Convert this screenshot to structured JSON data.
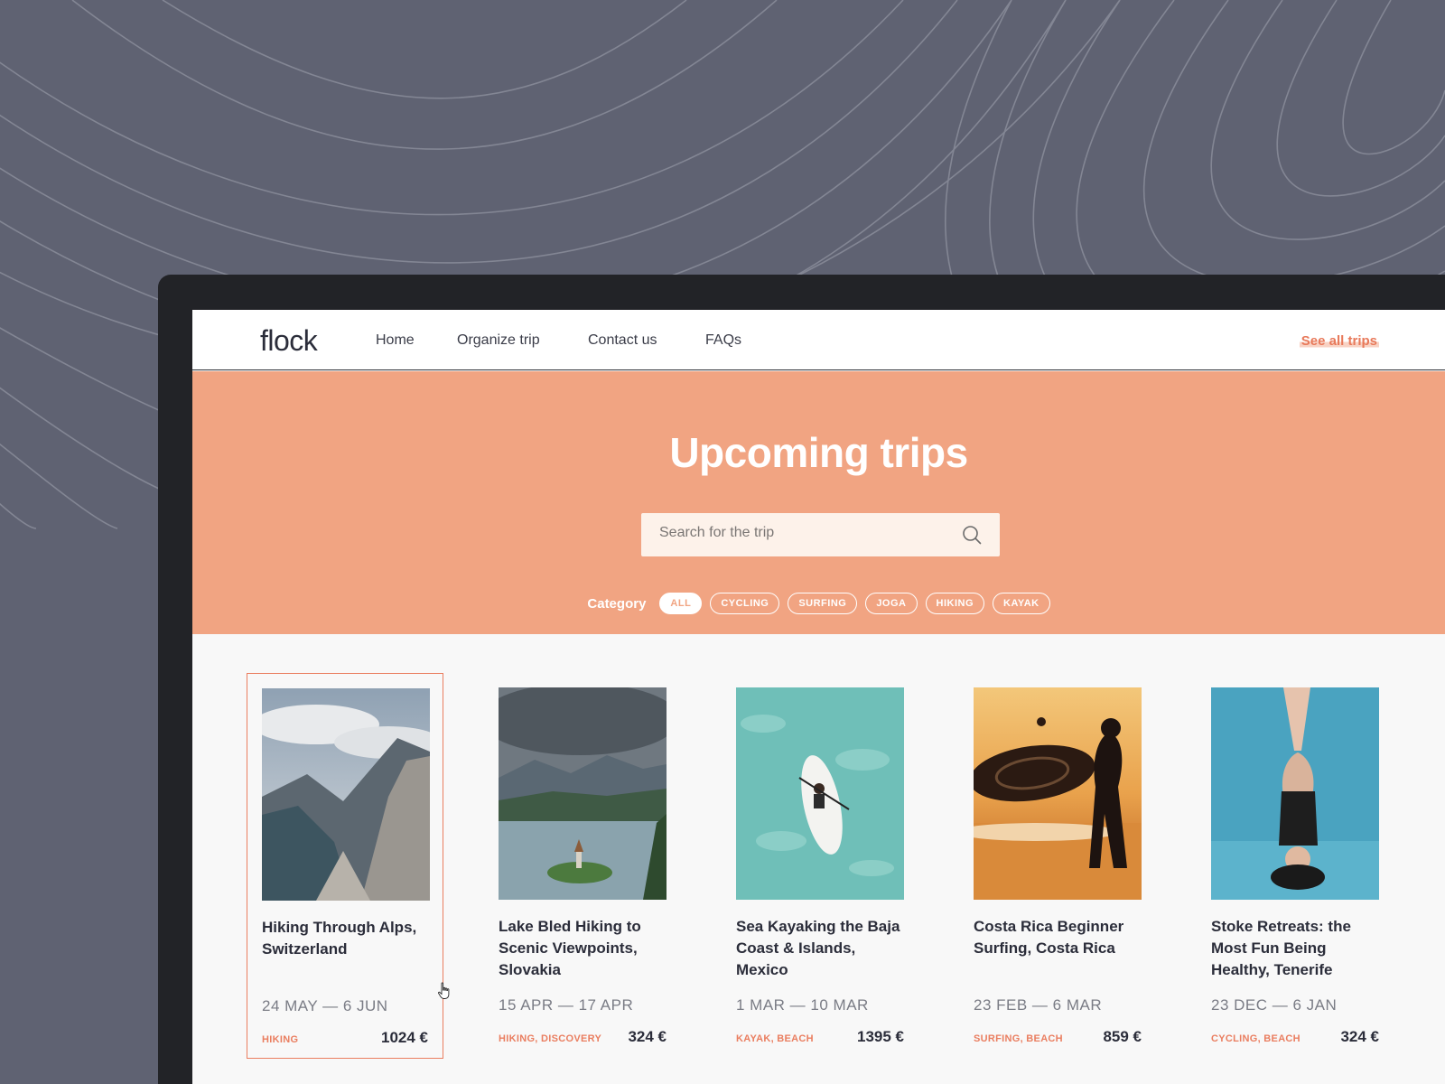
{
  "nav": {
    "logo": "flock",
    "links": [
      "Home",
      "Organize trip",
      "Contact us",
      "FAQs"
    ],
    "see_all": "See all trips"
  },
  "hero": {
    "title": "Upcoming trips",
    "search_placeholder": "Search for the trip",
    "category_label": "Category",
    "categories": [
      "ALL",
      "CYCLING",
      "SURFING",
      "JOGA",
      "HIKING",
      "KAYAK"
    ],
    "active_category": "ALL"
  },
  "cards": [
    {
      "title": "Hiking Through Alps, Switzerland",
      "dates": "24 MAY — 6 JUN",
      "tags": "HIKING",
      "price": "1024 €",
      "selected": true
    },
    {
      "title": "Lake Bled Hiking to Scenic Viewpoints, Slovakia",
      "dates": "15 APR — 17 APR",
      "tags": "HIKING, DISCOVERY",
      "price": "324 €"
    },
    {
      "title": "Sea Kayaking the Baja Coast & Islands, Mexico",
      "dates": "1 MAR — 10 MAR",
      "tags": "KAYAK, BEACH",
      "price": "1395 €"
    },
    {
      "title": "Costa Rica Beginner Surfing, Costa Rica",
      "dates": "23 FEB — 6 MAR",
      "tags": "SURFING, BEACH",
      "price": "859 €"
    },
    {
      "title": "Stoke Retreats: the Most Fun Being Healthy, Tenerife",
      "dates": "23 DEC — 6 JAN",
      "tags": "CYCLING, BEACH",
      "price": "324 €"
    }
  ],
  "colors": {
    "accent": "#f1a482",
    "accent_text": "#ea7e60",
    "background": "#5f6272",
    "device": "#222327"
  }
}
